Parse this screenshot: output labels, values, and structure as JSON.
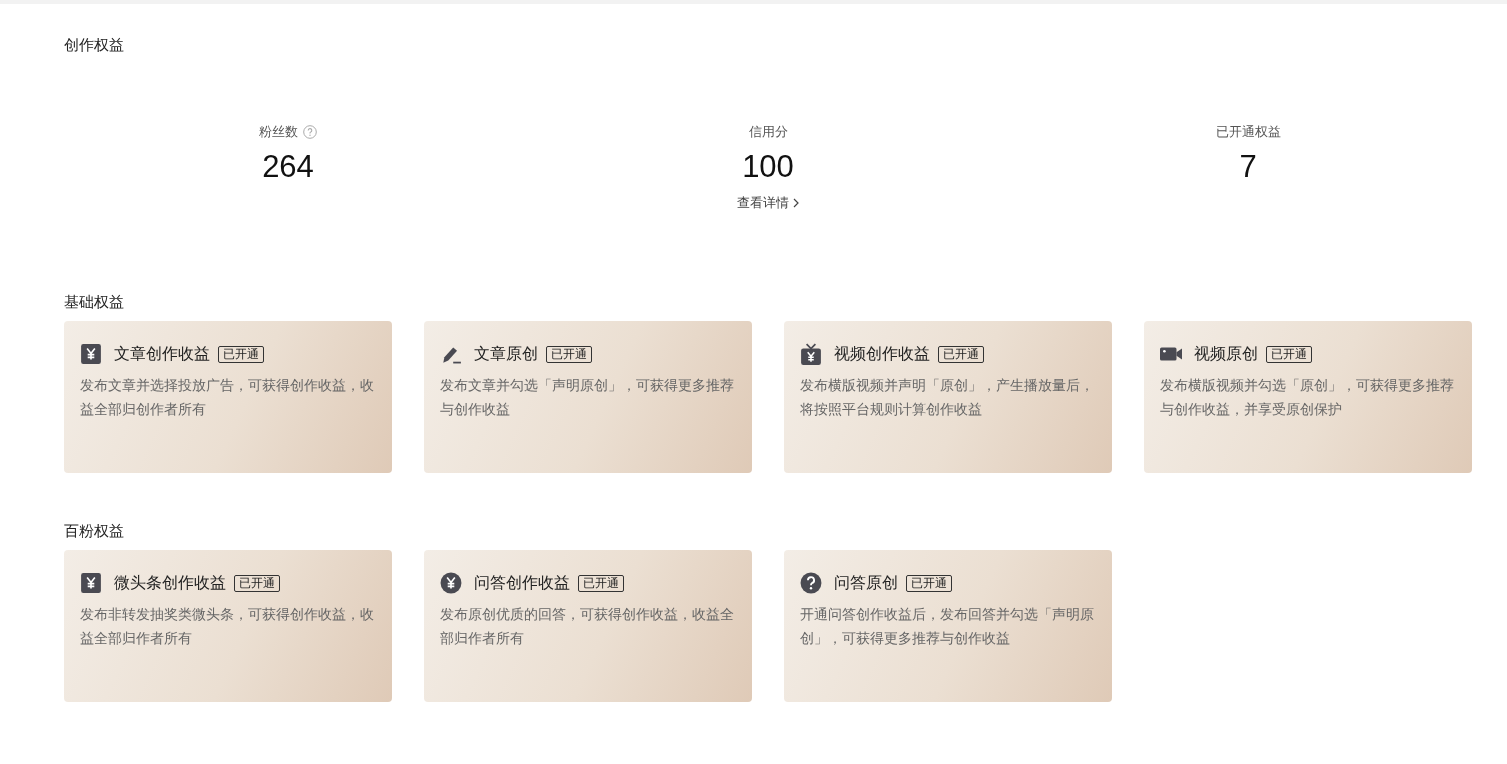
{
  "title": "创作权益",
  "stats": [
    {
      "label": "粉丝数",
      "help": true,
      "value": "264"
    },
    {
      "label": "信用分",
      "help": false,
      "value": "100",
      "link": "查看详情"
    },
    {
      "label": "已开通权益",
      "help": false,
      "value": "7"
    }
  ],
  "sections": [
    {
      "title": "基础权益",
      "cards": [
        {
          "kind": "yen-square",
          "name": "文章创作收益",
          "tag": "已开通",
          "desc": "发布文章并选择投放广告，可获得创作收益，收益全部归创作者所有"
        },
        {
          "kind": "pencil",
          "name": "文章原创",
          "tag": "已开通",
          "desc": "发布文章并勾选「声明原创」，可获得更多推荐与创作收益"
        },
        {
          "kind": "tv-yen",
          "name": "视频创作收益",
          "tag": "已开通",
          "desc": "发布横版视频并声明「原创」，产生播放量后，将按照平台规则计算创作收益"
        },
        {
          "kind": "camera",
          "name": "视频原创",
          "tag": "已开通",
          "desc": "发布横版视频并勾选「原创」，可获得更多推荐与创作收益，并享受原创保护"
        }
      ]
    },
    {
      "title": "百粉权益",
      "cards": [
        {
          "kind": "yen-square",
          "name": "微头条创作收益",
          "tag": "已开通",
          "desc": "发布非转发抽奖类微头条，可获得创作收益，收益全部归作者所有"
        },
        {
          "kind": "yen-circle",
          "name": "问答创作收益",
          "tag": "已开通",
          "desc": "发布原创优质的回答，可获得创作收益，收益全部归作者所有"
        },
        {
          "kind": "question-circle",
          "name": "问答原创",
          "tag": "已开通",
          "desc": "开通问答创作收益后，发布回答并勾选「声明原创」，可获得更多推荐与创作收益"
        }
      ]
    }
  ]
}
